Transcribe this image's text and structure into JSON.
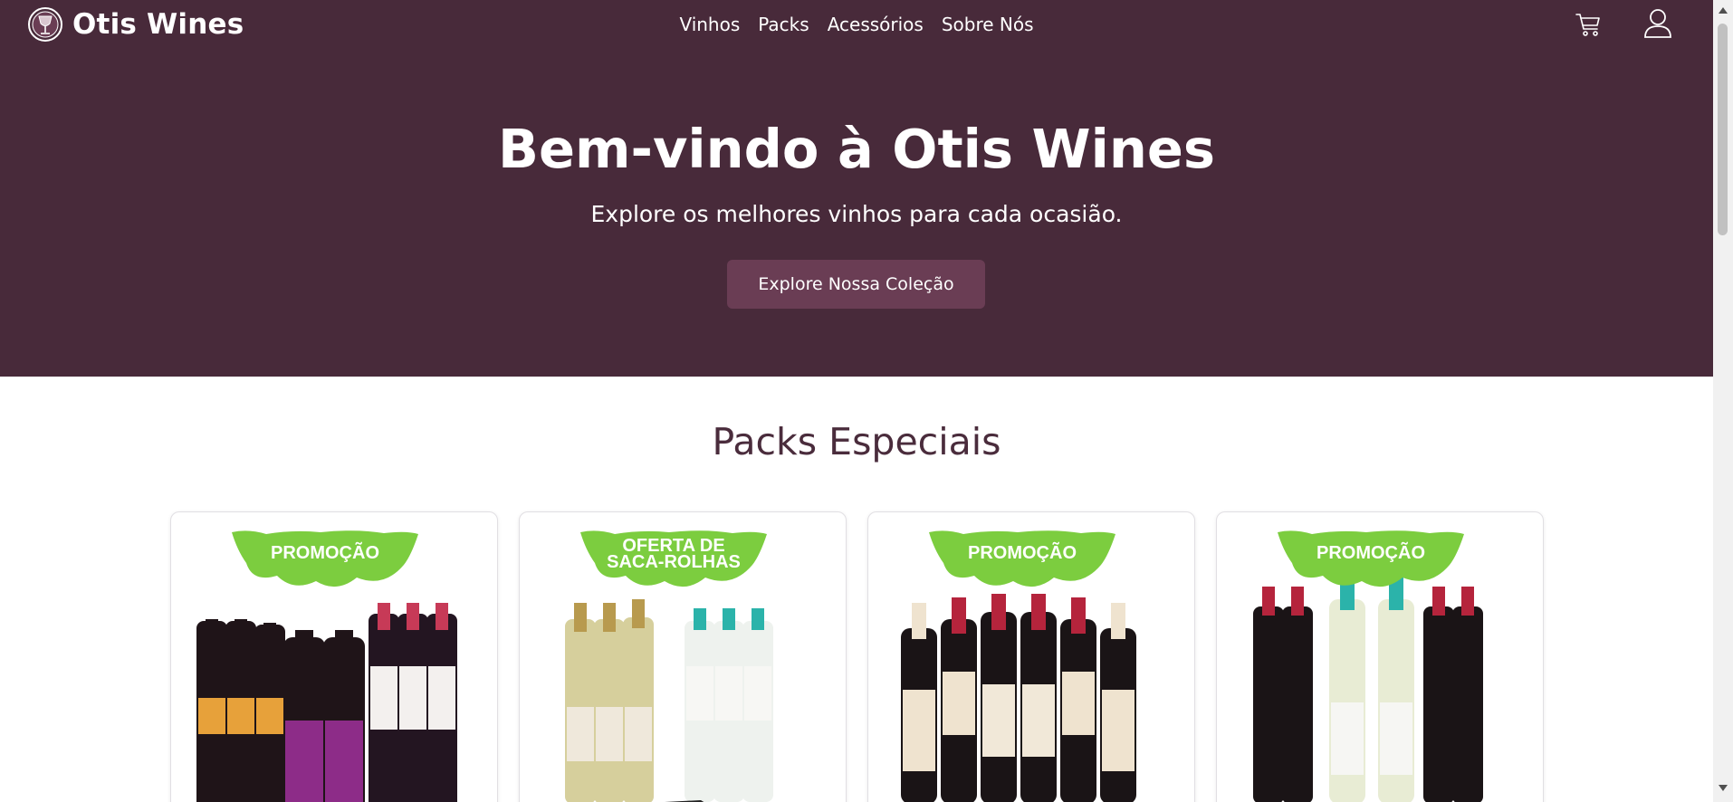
{
  "header": {
    "brand": "Otis Wines",
    "nav": [
      "Vinhos",
      "Packs",
      "Acessórios",
      "Sobre Nós"
    ]
  },
  "hero": {
    "title": "Bem-vindo à Otis Wines",
    "subtitle": "Explore os melhores vinhos para cada ocasião.",
    "cta": "Explore Nossa Coleção"
  },
  "packs": {
    "title": "Packs Especiais",
    "items": [
      {
        "badge_line1": "PROMOÇÃO",
        "badge_line2": ""
      },
      {
        "badge_line1": "OFERTA DE",
        "badge_line2": "SACA-ROLHAS"
      },
      {
        "badge_line1": "PROMOÇÃO",
        "badge_line2": ""
      },
      {
        "badge_line1": "PROMOÇÃO",
        "badge_line2": ""
      }
    ]
  },
  "colors": {
    "header_bg": "#482a3a",
    "button_bg": "#6a3d54",
    "badge_green": "#7ccd3f",
    "section_title": "#4a2c3c"
  },
  "icons": {
    "logo": "wine-glass-logo-icon",
    "cart": "cart-icon",
    "user": "user-icon"
  }
}
